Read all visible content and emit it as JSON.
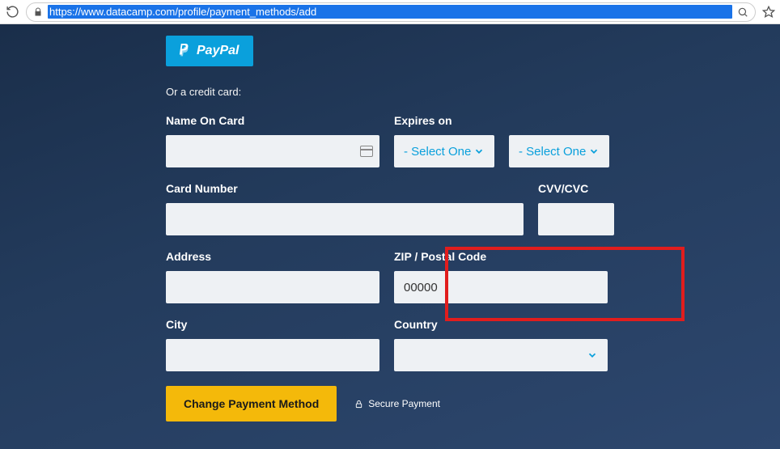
{
  "browser": {
    "url": "https://www.datacamp.com/profile/payment_methods/add"
  },
  "paypal": {
    "label": "PayPal"
  },
  "or_text": "Or a credit card:",
  "form": {
    "name": {
      "label": "Name On Card",
      "value": ""
    },
    "expires": {
      "label": "Expires on",
      "month_placeholder": "- Select One",
      "year_placeholder": "- Select One"
    },
    "card": {
      "label": "Card Number",
      "value": ""
    },
    "cvv": {
      "label": "CVV/CVC",
      "value": ""
    },
    "address": {
      "label": "Address",
      "value": ""
    },
    "zip": {
      "label": "ZIP / Postal Code",
      "value": "00000"
    },
    "city": {
      "label": "City",
      "value": ""
    },
    "country": {
      "label": "Country",
      "value": ""
    }
  },
  "actions": {
    "submit_label": "Change Payment Method",
    "secure_label": "Secure Payment"
  }
}
